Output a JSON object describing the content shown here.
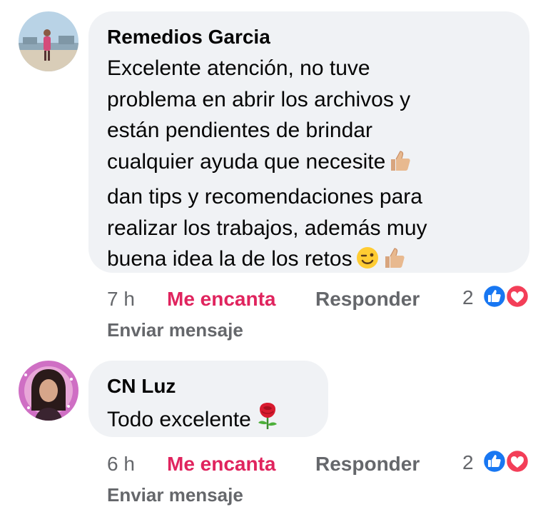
{
  "comments": [
    {
      "author": "Remedios Garcia",
      "lines": [
        "Excelente atención, no tuve",
        "problema en abrir los archivos y",
        "están pendientes de brindar",
        "cualquier ayuda que necesite",
        "dan tips y recomendaciones para",
        "realizar los trabajos, además muy",
        "buena idea la de los retos"
      ],
      "time": "7 h",
      "love_label": "Me encanta",
      "reply_label": "Responder",
      "reaction_count": "2",
      "send_message_label": "Enviar mensaje",
      "avatar_icon": "avatar-photo-woman-seaside",
      "emoji_icons": [
        "thumbs-up-icon",
        "winking-face-icon",
        "thumbs-up-icon"
      ]
    },
    {
      "author": "CN Luz",
      "lines": [
        "Todo excelente"
      ],
      "time": "6 h",
      "love_label": "Me encanta",
      "reply_label": "Responder",
      "reaction_count": "2",
      "send_message_label": "Enviar mensaje",
      "avatar_icon": "avatar-photo-woman-purple-frame",
      "emoji_icons": [
        "rose-icon"
      ]
    }
  ],
  "colors": {
    "bubble": "#f0f2f5",
    "meta_text": "#65676b",
    "love_text": "#e0245e",
    "like_blue": "#1877f2",
    "love_red": "#f33e58"
  },
  "reaction_icons": [
    "like-reaction-icon",
    "love-reaction-icon"
  ]
}
